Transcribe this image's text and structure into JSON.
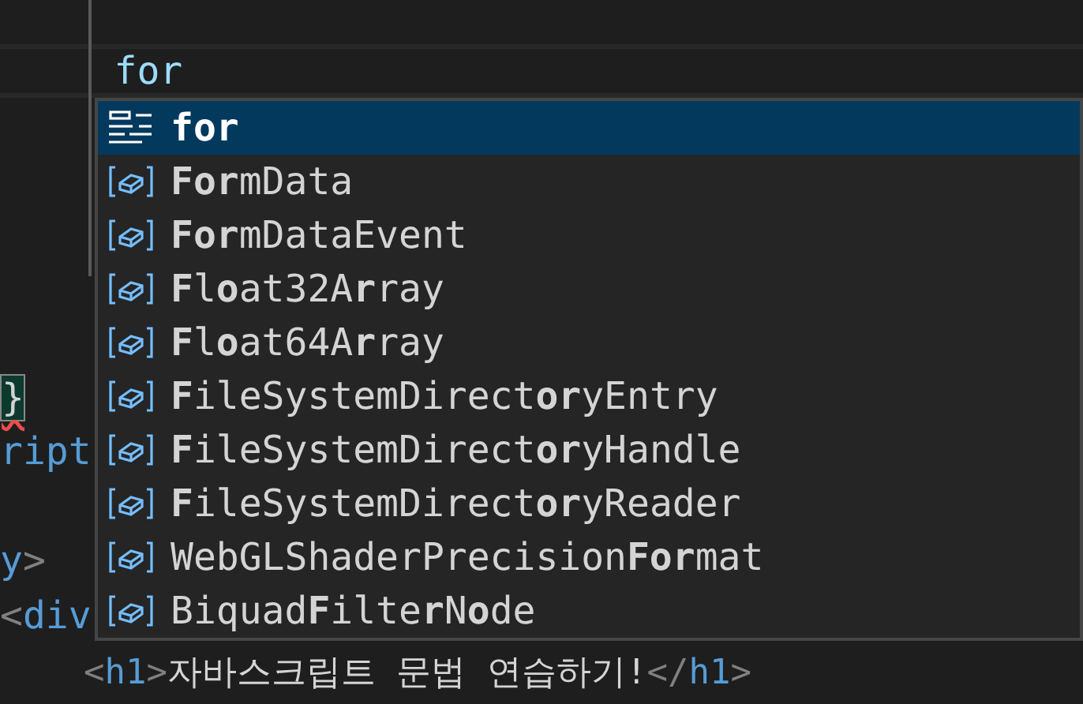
{
  "editor": {
    "code_lines": [
      {
        "kind": "blank"
      },
      {
        "kind": "current",
        "segments": [
          {
            "text": "     for",
            "kind": "variable"
          }
        ]
      },
      {
        "kind": "blank"
      },
      {
        "kind": "blank"
      },
      {
        "kind": "blank"
      },
      {
        "kind": "blank"
      },
      {
        "kind": "blank"
      },
      {
        "kind": "code",
        "segments": [
          {
            "text": "}",
            "kind": "bracket-match"
          }
        ]
      },
      {
        "kind": "code",
        "segments": [
          {
            "text": "ript",
            "kind": "tag"
          }
        ]
      },
      {
        "kind": "blank"
      },
      {
        "kind": "code",
        "segments": [
          {
            "text": "y",
            "kind": "tag"
          },
          {
            "text": ">",
            "kind": "punct"
          }
        ]
      },
      {
        "kind": "code",
        "segments": [
          {
            "text": "<",
            "kind": "punct"
          },
          {
            "text": "div",
            "kind": "tag"
          }
        ]
      },
      {
        "kind": "code",
        "segments": [
          {
            "text": "    <",
            "kind": "punct"
          },
          {
            "text": "h1",
            "kind": "tag"
          },
          {
            "text": ">",
            "kind": "punct"
          },
          {
            "text": "자바스크립트 문법 연습하기!",
            "kind": "text"
          },
          {
            "text": "</",
            "kind": "punct"
          },
          {
            "text": "h1",
            "kind": "tag"
          },
          {
            "text": ">",
            "kind": "punct"
          }
        ]
      }
    ]
  },
  "suggestions": [
    {
      "label": "**for**",
      "kind": "keyword",
      "selected": true
    },
    {
      "label": "**For**mData",
      "kind": "variable",
      "selected": false
    },
    {
      "label": "**For**mDataEvent",
      "kind": "variable",
      "selected": false
    },
    {
      "label": "**F**l**o**at32A**r**ray",
      "kind": "variable",
      "selected": false
    },
    {
      "label": "**F**l**o**at64A**r**ray",
      "kind": "variable",
      "selected": false
    },
    {
      "label": "**F**ileSystemDirect**or**yEntry",
      "kind": "variable",
      "selected": false
    },
    {
      "label": "**F**ileSystemDirect**or**yHandle",
      "kind": "variable",
      "selected": false
    },
    {
      "label": "**F**ileSystemDirect**or**yReader",
      "kind": "variable",
      "selected": false
    },
    {
      "label": "WebGLShaderPrecision**For**mat",
      "kind": "variable",
      "selected": false
    },
    {
      "label": "Biquad**F**ilte**r**N**o**de",
      "kind": "variable",
      "selected": false
    }
  ]
}
